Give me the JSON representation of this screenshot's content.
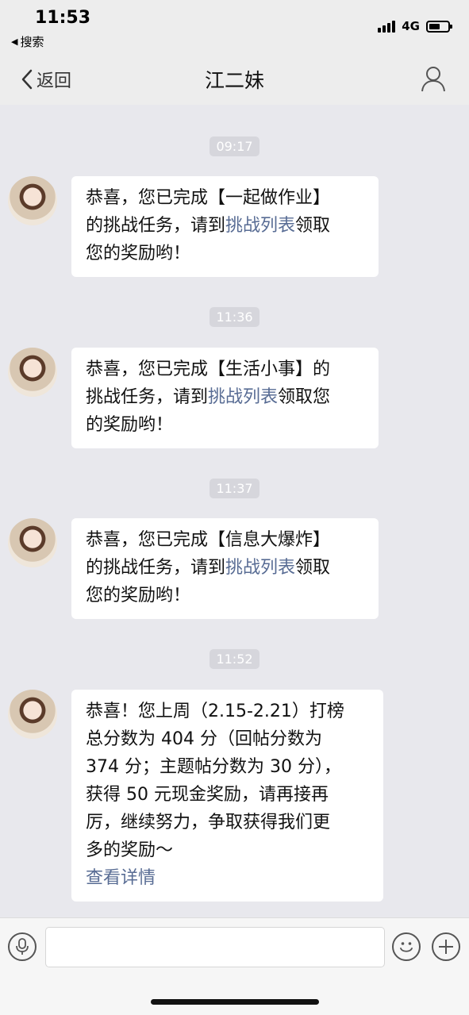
{
  "status_bar": {
    "time": "11:53",
    "back_app": "搜索",
    "network": "4G",
    "battery_level": 0.6
  },
  "nav": {
    "back_label": "返回",
    "title": "江二妹",
    "profile_icon": "person-icon"
  },
  "messages": [
    {
      "timestamp": "09:17",
      "lines": [
        [
          {
            "t": "恭喜，您已完成【一起做作业】"
          }
        ],
        [
          {
            "t": "的挑战任务，请到"
          },
          {
            "t": "挑战列表",
            "link": true
          },
          {
            "t": "领取"
          }
        ],
        [
          {
            "t": "您的奖励哟！"
          }
        ]
      ]
    },
    {
      "timestamp": "11:36",
      "lines": [
        [
          {
            "t": "恭喜，您已完成【生活小事】的"
          }
        ],
        [
          {
            "t": "挑战任务，请到"
          },
          {
            "t": "挑战列表",
            "link": true
          },
          {
            "t": "领取您"
          }
        ],
        [
          {
            "t": "的奖励哟！"
          }
        ]
      ]
    },
    {
      "timestamp": "11:37",
      "lines": [
        [
          {
            "t": "恭喜，您已完成【信息大爆炸】"
          }
        ],
        [
          {
            "t": "的挑战任务，请到"
          },
          {
            "t": "挑战列表",
            "link": true
          },
          {
            "t": "领取"
          }
        ],
        [
          {
            "t": "您的奖励哟！"
          }
        ]
      ]
    },
    {
      "timestamp": "11:52",
      "lines": [
        [
          {
            "t": "恭喜！您上周（2.15-2.21）打榜"
          }
        ],
        [
          {
            "t": "总分数为 404 分（回帖分数为"
          }
        ],
        [
          {
            "t": "374 分；主题帖分数为 30 分），"
          }
        ],
        [
          {
            "t": "获得 50 元现金奖励，请再接再"
          }
        ],
        [
          {
            "t": "厉，继续努力，争取获得我们更"
          }
        ],
        [
          {
            "t": "多的奖励～"
          }
        ],
        [
          {
            "t": "查看详情",
            "link": true
          }
        ]
      ]
    }
  ],
  "input": {
    "placeholder": "",
    "value": ""
  },
  "colors": {
    "link": "#586c94",
    "chat_bg": "#e8e8ed",
    "bubble": "#ffffff"
  }
}
